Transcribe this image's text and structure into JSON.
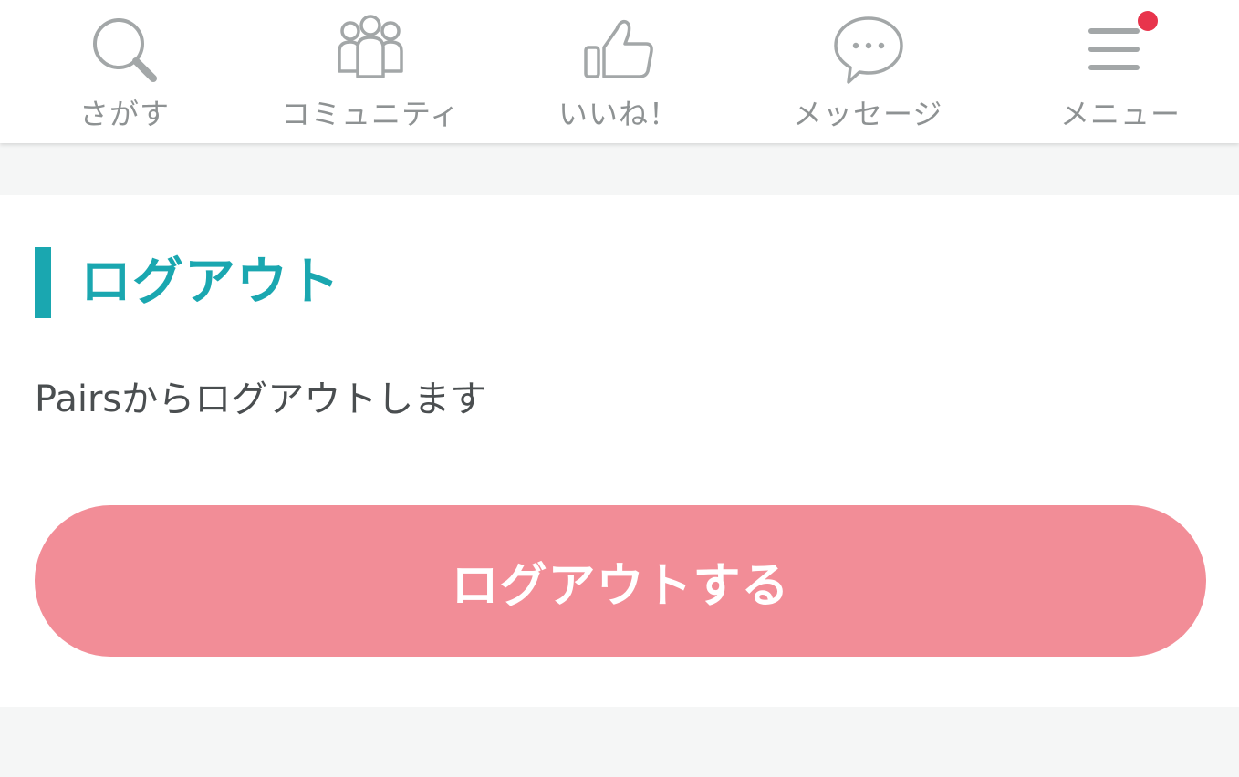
{
  "tabbar": {
    "tabs": [
      {
        "label": "さがす",
        "icon": "search-icon"
      },
      {
        "label": "コミュニティ",
        "icon": "community-icon"
      },
      {
        "label": "いいね！",
        "icon": "thumbs-up-icon"
      },
      {
        "label": "メッセージ",
        "icon": "chat-bubble-icon"
      },
      {
        "label": "メニュー",
        "icon": "menu-icon",
        "has_notification": true
      }
    ]
  },
  "logout": {
    "title": "ログアウト",
    "description": "Pairsからログアウトします",
    "button_label": "ログアウトする"
  },
  "colors": {
    "accent": "#1aa7b0",
    "button": "#f28d97",
    "notification": "#e8344c",
    "tab_inactive": "#8e9293"
  }
}
